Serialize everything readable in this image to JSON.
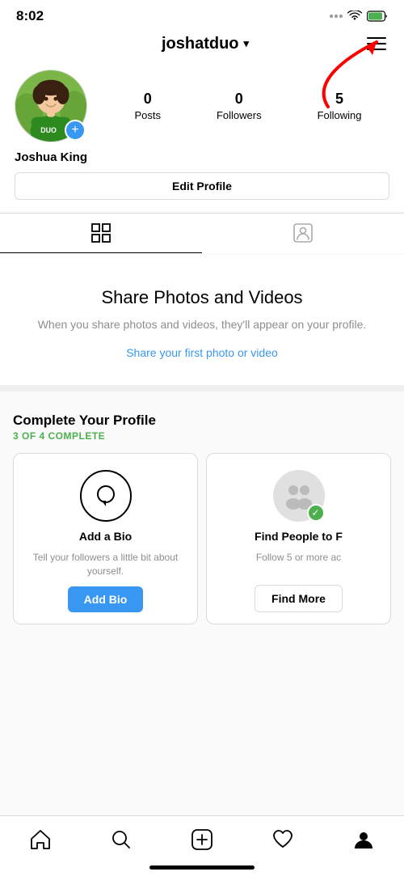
{
  "statusBar": {
    "time": "8:02"
  },
  "header": {
    "username": "joshatduo",
    "chevron": "▾",
    "menu_label": "menu"
  },
  "profile": {
    "name": "Joshua King",
    "stats": {
      "posts": {
        "count": "0",
        "label": "Posts"
      },
      "followers": {
        "count": "0",
        "label": "Followers"
      },
      "following": {
        "count": "5",
        "label": "Following"
      }
    },
    "edit_btn": "Edit Profile"
  },
  "tabs": [
    {
      "id": "grid",
      "icon": "grid",
      "active": true
    },
    {
      "id": "tagged",
      "icon": "person",
      "active": false
    }
  ],
  "emptyState": {
    "title": "Share Photos and Videos",
    "subtitle": "When you share photos and videos, they'll appear on your profile.",
    "link": "Share your first photo or video"
  },
  "completeProfile": {
    "title": "Complete Your Profile",
    "progress": "3 OF 4 COMPLETE",
    "cards": [
      {
        "id": "add-bio",
        "title": "Add a Bio",
        "description": "Tell your followers a little bit about yourself.",
        "button": "Add Bio",
        "button_type": "primary",
        "icon_type": "bubble"
      },
      {
        "id": "find-people",
        "title": "Find People to F",
        "description": "Follow 5 or more ac",
        "button": "Find More",
        "button_type": "outline",
        "icon_type": "people",
        "completed": true
      }
    ]
  },
  "bottomNav": [
    {
      "id": "home",
      "label": "home"
    },
    {
      "id": "search",
      "label": "search"
    },
    {
      "id": "add",
      "label": "add"
    },
    {
      "id": "heart",
      "label": "heart"
    },
    {
      "id": "profile",
      "label": "profile"
    }
  ]
}
